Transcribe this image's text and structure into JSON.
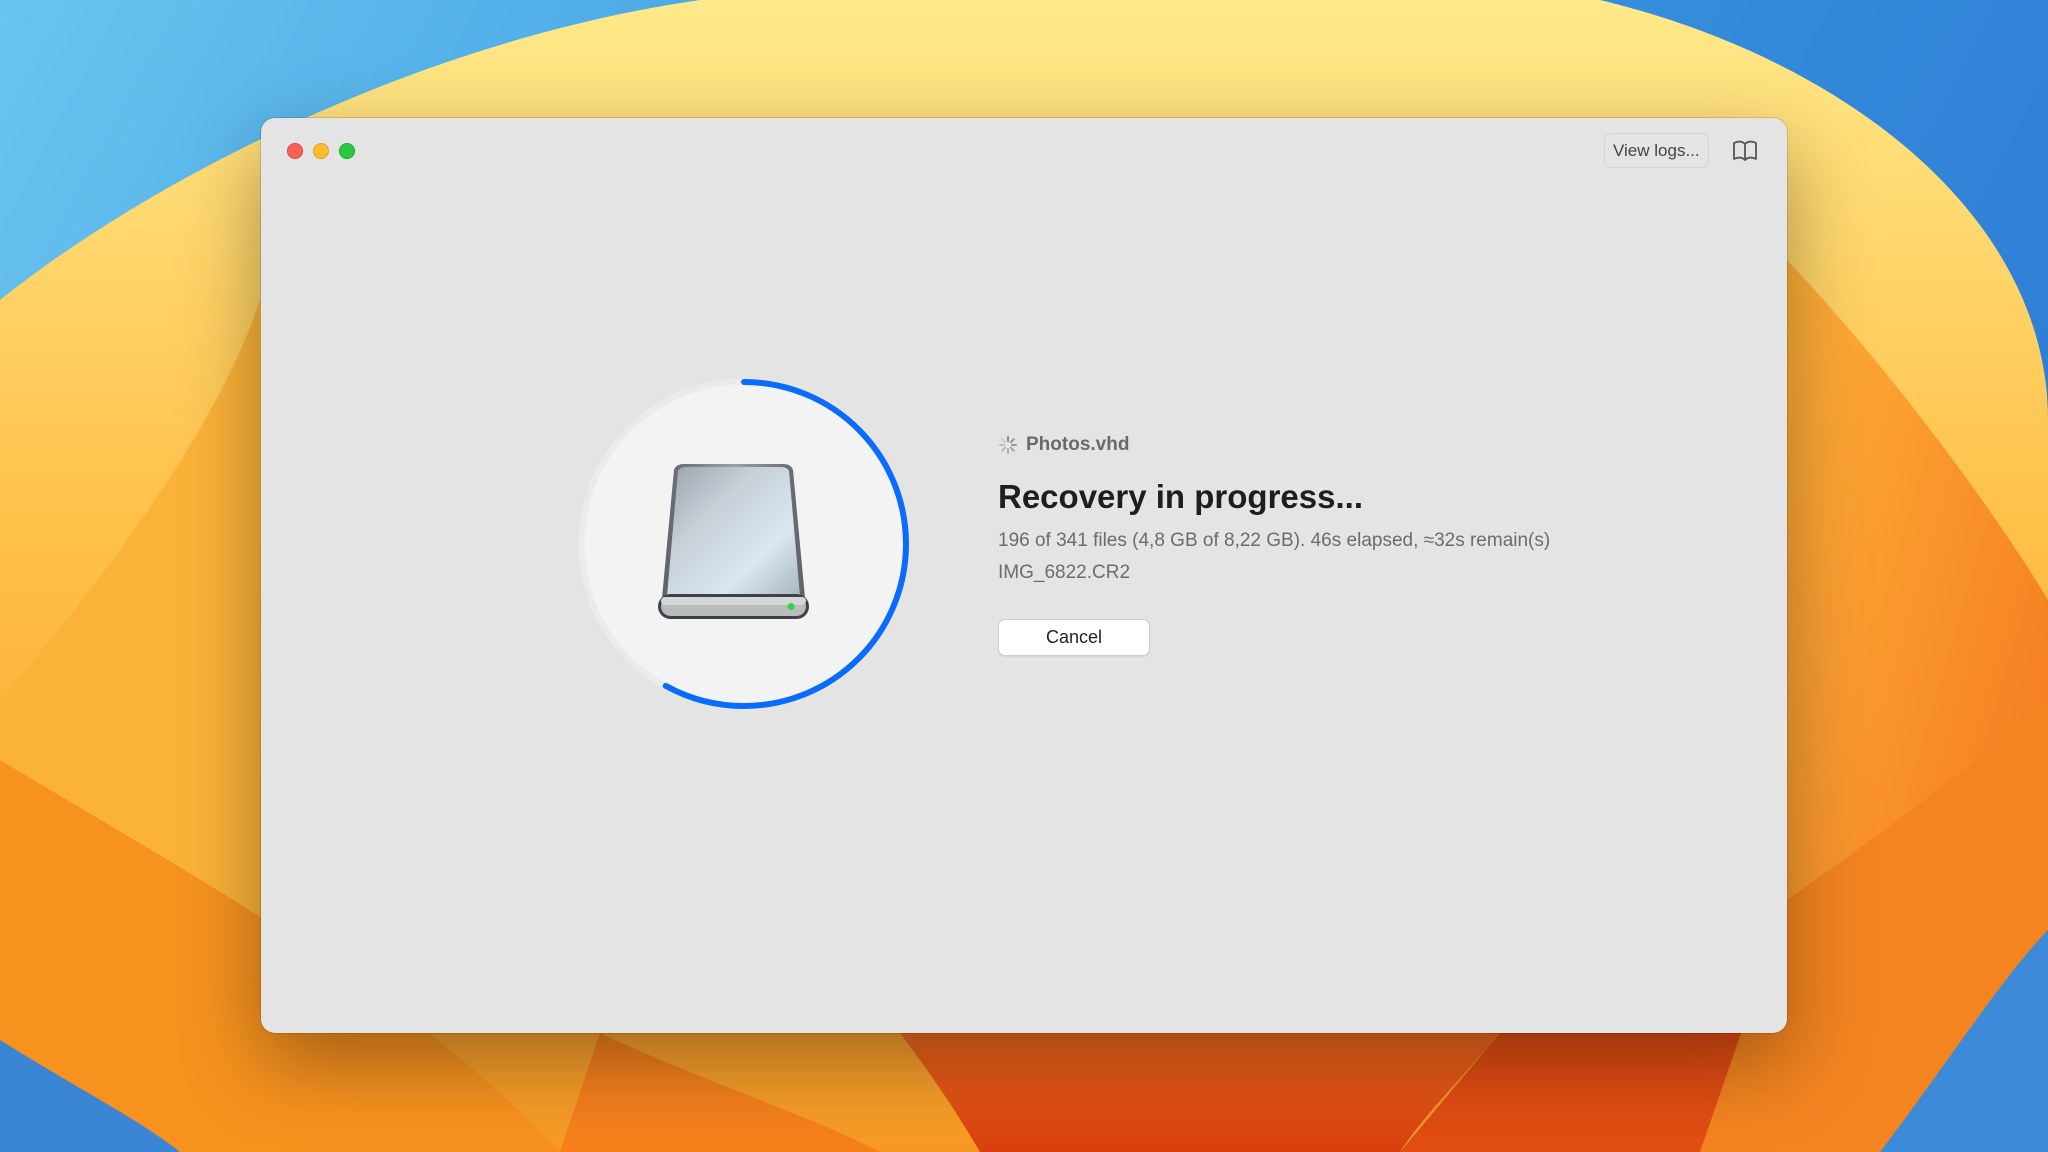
{
  "theme": {
    "accent": "#0a6cff",
    "window_bg": "#e4e4e4"
  },
  "toolbar": {
    "view_logs_label": "View logs...",
    "help_icon": "book-icon"
  },
  "recovery": {
    "source_icon": "spinner-icon",
    "source_name": "Photos.vhd",
    "title": "Recovery in progress...",
    "status": "196 of 341 files (4,8 GB of 8,22 GB). 46s elapsed, ≈32s remain(s)",
    "current_file": "IMG_6822.CR2",
    "cancel_label": "Cancel",
    "progress_fraction": 0.58,
    "drive_icon": "external-drive-icon"
  }
}
